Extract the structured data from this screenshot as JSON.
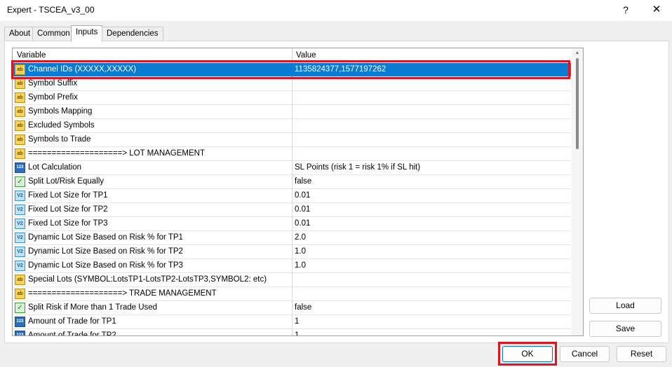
{
  "window": {
    "title": "Expert - TSCEA_v3_00",
    "help": "?",
    "close": "✕"
  },
  "tabs": [
    {
      "label": "About"
    },
    {
      "label": "Common"
    },
    {
      "label": "Inputs"
    },
    {
      "label": "Dependencies"
    }
  ],
  "grid": {
    "headers": {
      "variable": "Variable",
      "value": "Value"
    },
    "rows": [
      {
        "icon": "ab",
        "name": "Channel IDs (XXXXX,XXXXX)",
        "value": "1135824377,1577197262"
      },
      {
        "icon": "ab",
        "name": "Symbol Suffix",
        "value": ""
      },
      {
        "icon": "ab",
        "name": "Symbol Prefix",
        "value": ""
      },
      {
        "icon": "ab",
        "name": "Symbols Mapping",
        "value": ""
      },
      {
        "icon": "ab",
        "name": "Excluded Symbols",
        "value": ""
      },
      {
        "icon": "ab",
        "name": "Symbols to Trade",
        "value": ""
      },
      {
        "icon": "ab",
        "name": "====================> LOT MANAGEMENT",
        "value": ""
      },
      {
        "icon": "123",
        "name": "Lot Calculation",
        "value": "SL Points (risk 1 = risk 1% if SL hit)"
      },
      {
        "icon": "chk",
        "name": "Split Lot/Risk Equally",
        "value": "false"
      },
      {
        "icon": "v2",
        "name": "Fixed Lot Size for TP1",
        "value": "0.01"
      },
      {
        "icon": "v2",
        "name": "Fixed Lot Size for TP2",
        "value": "0.01"
      },
      {
        "icon": "v2",
        "name": "Fixed Lot Size for TP3",
        "value": "0.01"
      },
      {
        "icon": "v2",
        "name": "Dynamic Lot Size Based on Risk % for TP1",
        "value": "2.0"
      },
      {
        "icon": "v2",
        "name": "Dynamic Lot Size Based on Risk % for TP2",
        "value": "1.0"
      },
      {
        "icon": "v2",
        "name": "Dynamic Lot Size Based on Risk % for TP3",
        "value": "1.0"
      },
      {
        "icon": "ab",
        "name": "Special Lots (SYMBOL:LotsTP1-LotsTP2-LotsTP3,SYMBOL2: etc)",
        "value": ""
      },
      {
        "icon": "ab",
        "name": "====================> TRADE MANAGEMENT",
        "value": ""
      },
      {
        "icon": "chk",
        "name": "Split Risk if More than 1 Trade Used",
        "value": "false"
      },
      {
        "icon": "123",
        "name": "Amount of Trade for TP1",
        "value": "1"
      },
      {
        "icon": "123",
        "name": "Amount of Trade for TP2",
        "value": "1"
      }
    ]
  },
  "buttons": {
    "load": "Load",
    "save": "Save",
    "ok": "OK",
    "cancel": "Cancel",
    "reset": "Reset"
  }
}
